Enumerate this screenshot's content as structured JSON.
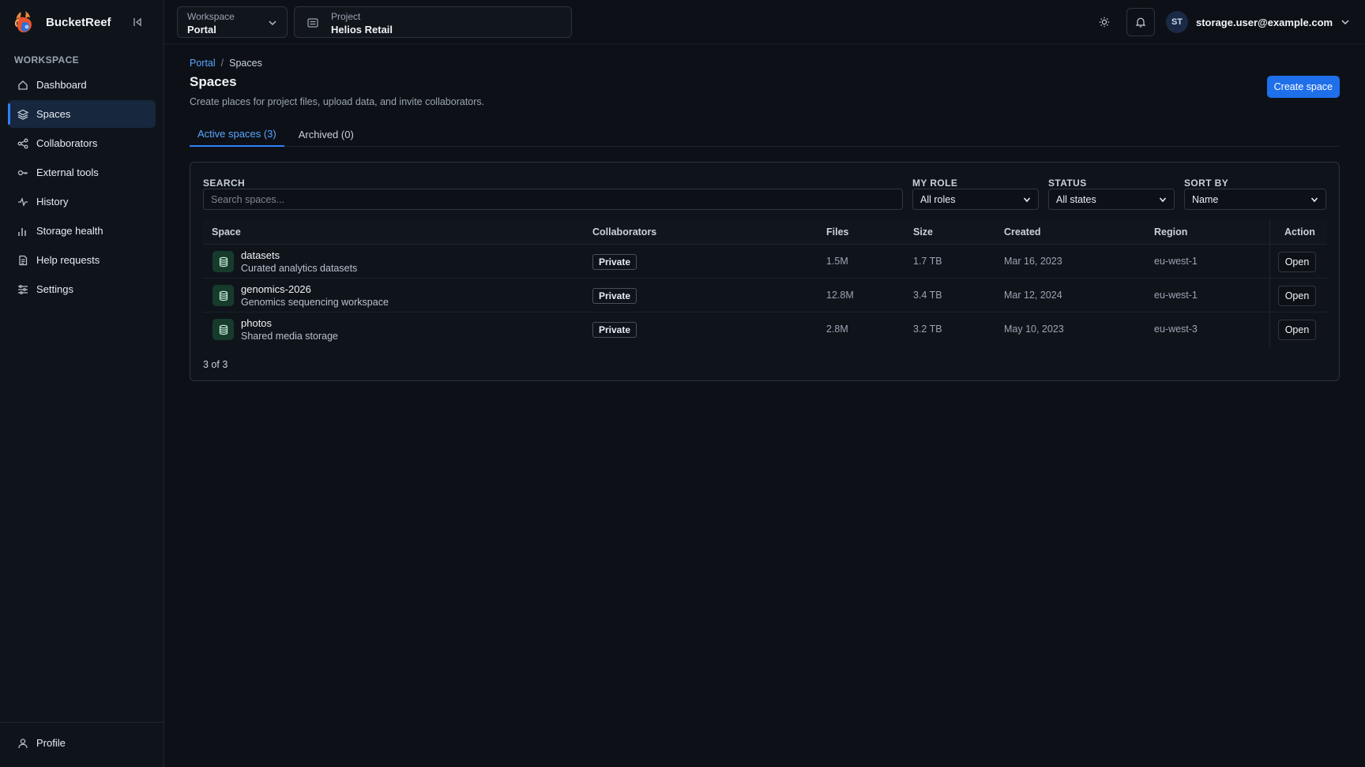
{
  "app": {
    "name": "BucketReef"
  },
  "sidebar": {
    "section_label": "WORKSPACE",
    "items": [
      {
        "label": "Dashboard",
        "icon": "home-icon"
      },
      {
        "label": "Spaces",
        "icon": "layers-icon",
        "active": true
      },
      {
        "label": "Collaborators",
        "icon": "share-icon"
      },
      {
        "label": "External tools",
        "icon": "key-icon"
      },
      {
        "label": "History",
        "icon": "activity-icon"
      },
      {
        "label": "Storage health",
        "icon": "bar-chart-icon"
      },
      {
        "label": "Help requests",
        "icon": "document-icon"
      },
      {
        "label": "Settings",
        "icon": "sliders-icon"
      }
    ],
    "footer": {
      "label": "Profile",
      "icon": "user-icon"
    }
  },
  "topbar": {
    "workspace": {
      "label": "Workspace",
      "value": "Portal"
    },
    "project": {
      "label": "Project",
      "value": "Helios Retail"
    },
    "user": {
      "initials": "ST",
      "email": "storage.user@example.com"
    }
  },
  "page": {
    "breadcrumb": {
      "parent": "Portal",
      "separator": "/",
      "current": "Spaces"
    },
    "title": "Spaces",
    "description": "Create places for project files, upload data, and invite collaborators.",
    "create_label": "Create space",
    "tabs": [
      {
        "label": "Active spaces (3)",
        "active": true
      },
      {
        "label": "Archived (0)",
        "active": false
      }
    ]
  },
  "filters": {
    "search": {
      "label": "SEARCH",
      "placeholder": "Search spaces..."
    },
    "role": {
      "label": "MY ROLE",
      "value": "All roles"
    },
    "status": {
      "label": "STATUS",
      "value": "All states"
    },
    "sort": {
      "label": "SORT BY",
      "value": "Name"
    }
  },
  "table": {
    "columns": [
      "Space",
      "Collaborators",
      "Files",
      "Size",
      "Created",
      "Region",
      "Action"
    ],
    "rows": [
      {
        "name": "datasets",
        "description": "Curated analytics datasets",
        "collaborators": "Private",
        "files": "1.5M",
        "size": "1.7 TB",
        "created": "Mar 16, 2023",
        "region": "eu-west-1",
        "action": "Open"
      },
      {
        "name": "genomics-2026",
        "description": "Genomics sequencing workspace",
        "collaborators": "Private",
        "files": "12.8M",
        "size": "3.4 TB",
        "created": "Mar 12, 2024",
        "region": "eu-west-1",
        "action": "Open"
      },
      {
        "name": "photos",
        "description": "Shared media storage",
        "collaborators": "Private",
        "files": "2.8M",
        "size": "3.2 TB",
        "created": "May 10, 2023",
        "region": "eu-west-3",
        "action": "Open"
      }
    ],
    "count_text": "3 of 3"
  },
  "colors": {
    "background": "#0d1117",
    "sidebar": "#0f141b",
    "accent": "#2f81f7",
    "link": "#58a6ff",
    "space_icon_bg": "#163b2c"
  }
}
